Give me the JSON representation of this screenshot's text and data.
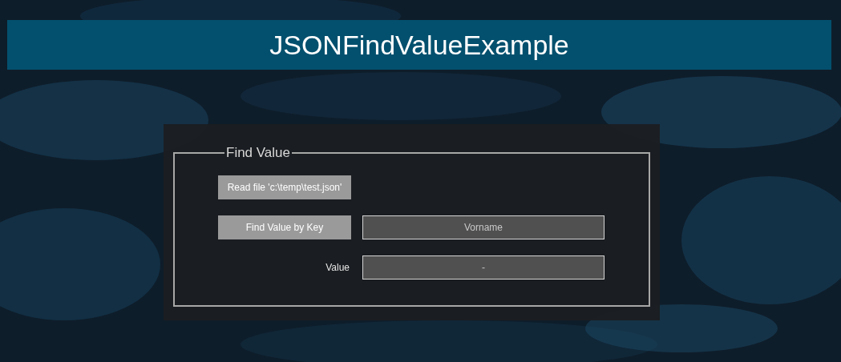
{
  "header": {
    "title": "JSONFindValueExample"
  },
  "group": {
    "legend": "Find Value",
    "read_button": "Read file 'c:\\temp\\test.json'",
    "find_button": "Find Value by Key",
    "key_field": {
      "value": "Vorname"
    },
    "value_label": "Value",
    "value_field": {
      "value": "-"
    }
  }
}
